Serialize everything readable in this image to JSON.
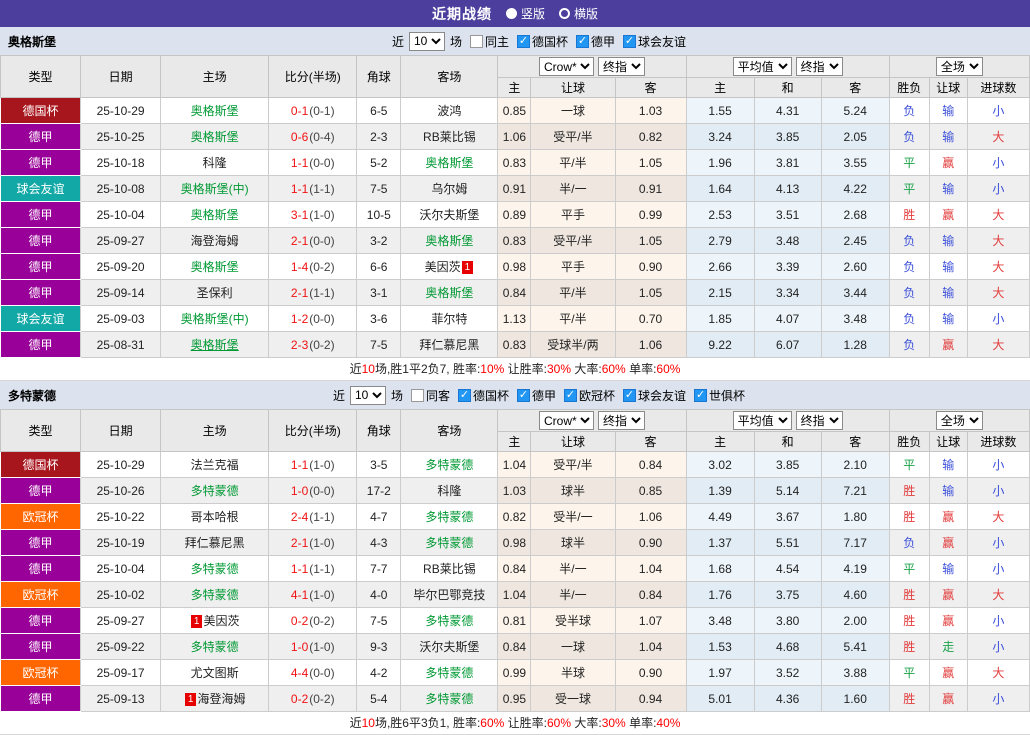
{
  "title_bar": {
    "title": "近期战绩",
    "radios": [
      {
        "label": "竖版",
        "selected": true
      },
      {
        "label": "横版",
        "selected": false
      }
    ]
  },
  "colors": {
    "title_bar_bg": "#4b3e9c",
    "section_bar_bg": "#dce3ee",
    "team_green": "#009933",
    "score_red": "#f01212",
    "badge_red": "#e60000",
    "check_blue": "#2196f3",
    "type": {
      "德国杯": "#a8161d",
      "德甲": "#990099",
      "球会友谊": "#12a8a6",
      "欧冠杯": "#ff6600"
    },
    "result": {
      "r": "#e23b3b",
      "g": "#1ba24a",
      "b": "#3a4fd8"
    }
  },
  "table_header": {
    "left": [
      "类型",
      "日期",
      "主场",
      "比分(半场)",
      "角球",
      "客场"
    ],
    "groups": [
      {
        "selects": [
          "Crow*",
          "终指"
        ],
        "cols": [
          "主",
          "让球",
          "客"
        ]
      },
      {
        "selects": [
          "平均值",
          "终指"
        ],
        "cols": [
          "主",
          "和",
          "客"
        ]
      },
      {
        "selects": [
          "全场"
        ],
        "cols": [
          "胜负",
          "让球",
          "进球数"
        ]
      }
    ]
  },
  "sections": [
    {
      "team": "奥格斯堡",
      "filters": {
        "recent_prefix": "近",
        "recent_value": "10",
        "recent_suffix": "场",
        "same": {
          "label": "同主",
          "checked": false
        },
        "competitions": [
          {
            "label": "德国杯",
            "checked": true
          },
          {
            "label": "德甲",
            "checked": true
          },
          {
            "label": "球会友谊",
            "checked": true
          }
        ]
      },
      "rows": [
        {
          "type": "德国杯",
          "date": "25-10-29",
          "home": {
            "name": "奥格斯堡",
            "green": true
          },
          "score": "0-1",
          "half": "(0-1)",
          "corner": "6-5",
          "away": {
            "name": "波鸿"
          },
          "crow": [
            "0.85",
            "一球",
            "1.03"
          ],
          "avg": [
            "1.55",
            "4.31",
            "5.24"
          ],
          "result": [
            [
              "负",
              "b"
            ],
            [
              "输",
              "b"
            ],
            [
              "小",
              "b"
            ]
          ]
        },
        {
          "type": "德甲",
          "date": "25-10-25",
          "home": {
            "name": "奥格斯堡",
            "green": true
          },
          "score": "0-6",
          "half": "(0-4)",
          "corner": "2-3",
          "away": {
            "name": "RB莱比锡"
          },
          "crow": [
            "1.06",
            "受平/半",
            "0.82"
          ],
          "avg": [
            "3.24",
            "3.85",
            "2.05"
          ],
          "result": [
            [
              "负",
              "b"
            ],
            [
              "输",
              "b"
            ],
            [
              "大",
              "r"
            ]
          ]
        },
        {
          "type": "德甲",
          "date": "25-10-18",
          "home": {
            "name": "科隆"
          },
          "score": "1-1",
          "half": "(0-0)",
          "corner": "5-2",
          "away": {
            "name": "奥格斯堡",
            "green": true
          },
          "crow": [
            "0.83",
            "平/半",
            "1.05"
          ],
          "avg": [
            "1.96",
            "3.81",
            "3.55"
          ],
          "result": [
            [
              "平",
              "g"
            ],
            [
              "赢",
              "r"
            ],
            [
              "小",
              "b"
            ]
          ]
        },
        {
          "type": "球会友谊",
          "date": "25-10-08",
          "home": {
            "name": "奥格斯堡(中)",
            "green": true
          },
          "score": "1-1",
          "half": "(1-1)",
          "corner": "7-5",
          "away": {
            "name": "乌尔姆"
          },
          "crow": [
            "0.91",
            "半/一",
            "0.91"
          ],
          "avg": [
            "1.64",
            "4.13",
            "4.22"
          ],
          "result": [
            [
              "平",
              "g"
            ],
            [
              "输",
              "b"
            ],
            [
              "小",
              "b"
            ]
          ]
        },
        {
          "type": "德甲",
          "date": "25-10-04",
          "home": {
            "name": "奥格斯堡",
            "green": true
          },
          "score": "3-1",
          "half": "(1-0)",
          "corner": "10-5",
          "away": {
            "name": "沃尔夫斯堡"
          },
          "crow": [
            "0.89",
            "平手",
            "0.99"
          ],
          "avg": [
            "2.53",
            "3.51",
            "2.68"
          ],
          "result": [
            [
              "胜",
              "r"
            ],
            [
              "赢",
              "r"
            ],
            [
              "大",
              "r"
            ]
          ]
        },
        {
          "type": "德甲",
          "date": "25-09-27",
          "home": {
            "name": "海登海姆"
          },
          "score": "2-1",
          "half": "(0-0)",
          "corner": "3-2",
          "away": {
            "name": "奥格斯堡",
            "green": true
          },
          "crow": [
            "0.83",
            "受平/半",
            "1.05"
          ],
          "avg": [
            "2.79",
            "3.48",
            "2.45"
          ],
          "result": [
            [
              "负",
              "b"
            ],
            [
              "输",
              "b"
            ],
            [
              "大",
              "r"
            ]
          ]
        },
        {
          "type": "德甲",
          "date": "25-09-20",
          "home": {
            "name": "奥格斯堡",
            "green": true
          },
          "score": "1-4",
          "half": "(0-2)",
          "corner": "6-6",
          "away": {
            "name": "美因茨",
            "badge": "1",
            "badge_pos": "after"
          },
          "crow": [
            "0.98",
            "平手",
            "0.90"
          ],
          "avg": [
            "2.66",
            "3.39",
            "2.60"
          ],
          "result": [
            [
              "负",
              "b"
            ],
            [
              "输",
              "b"
            ],
            [
              "大",
              "r"
            ]
          ]
        },
        {
          "type": "德甲",
          "date": "25-09-14",
          "home": {
            "name": "圣保利"
          },
          "score": "2-1",
          "half": "(1-1)",
          "corner": "3-1",
          "away": {
            "name": "奥格斯堡",
            "green": true
          },
          "crow": [
            "0.84",
            "平/半",
            "1.05"
          ],
          "avg": [
            "2.15",
            "3.34",
            "3.44"
          ],
          "result": [
            [
              "负",
              "b"
            ],
            [
              "输",
              "b"
            ],
            [
              "大",
              "r"
            ]
          ]
        },
        {
          "type": "球会友谊",
          "date": "25-09-03",
          "home": {
            "name": "奥格斯堡(中)",
            "green": true
          },
          "score": "1-2",
          "half": "(0-0)",
          "corner": "3-6",
          "away": {
            "name": "菲尔特"
          },
          "crow": [
            "1.13",
            "平/半",
            "0.70"
          ],
          "avg": [
            "1.85",
            "4.07",
            "3.48"
          ],
          "result": [
            [
              "负",
              "b"
            ],
            [
              "输",
              "b"
            ],
            [
              "小",
              "b"
            ]
          ]
        },
        {
          "type": "德甲",
          "date": "25-08-31",
          "home": {
            "name": "奥格斯堡",
            "green": true,
            "underline": true
          },
          "score": "2-3",
          "half": "(0-2)",
          "corner": "7-5",
          "away": {
            "name": "拜仁慕尼黑"
          },
          "crow": [
            "0.83",
            "受球半/两",
            "1.06"
          ],
          "avg": [
            "9.22",
            "6.07",
            "1.28"
          ],
          "result": [
            [
              "负",
              "b"
            ],
            [
              "赢",
              "r"
            ],
            [
              "大",
              "r"
            ]
          ]
        }
      ],
      "summary": [
        {
          "t": "近"
        },
        {
          "t": "10",
          "red": true
        },
        {
          "t": "场,胜1平2负7, 胜率:"
        },
        {
          "t": "10%",
          "red": true
        },
        {
          "t": " 让胜率:"
        },
        {
          "t": "30%",
          "red": true
        },
        {
          "t": " 大率:"
        },
        {
          "t": "60%",
          "red": true
        },
        {
          "t": " 单率:"
        },
        {
          "t": "60%",
          "red": true
        }
      ]
    },
    {
      "team": "多特蒙德",
      "filters": {
        "recent_prefix": "近",
        "recent_value": "10",
        "recent_suffix": "场",
        "same": {
          "label": "同客",
          "checked": false
        },
        "competitions": [
          {
            "label": "德国杯",
            "checked": true
          },
          {
            "label": "德甲",
            "checked": true
          },
          {
            "label": "欧冠杯",
            "checked": true
          },
          {
            "label": "球会友谊",
            "checked": true
          },
          {
            "label": "世俱杯",
            "checked": true
          }
        ]
      },
      "rows": [
        {
          "type": "德国杯",
          "date": "25-10-29",
          "home": {
            "name": "法兰克福"
          },
          "score": "1-1",
          "half": "(1-0)",
          "corner": "3-5",
          "away": {
            "name": "多特蒙德",
            "green": true
          },
          "crow": [
            "1.04",
            "受平/半",
            "0.84"
          ],
          "avg": [
            "3.02",
            "3.85",
            "2.10"
          ],
          "result": [
            [
              "平",
              "g"
            ],
            [
              "输",
              "b"
            ],
            [
              "小",
              "b"
            ]
          ]
        },
        {
          "type": "德甲",
          "date": "25-10-26",
          "home": {
            "name": "多特蒙德",
            "green": true
          },
          "score": "1-0",
          "half": "(0-0)",
          "corner": "17-2",
          "away": {
            "name": "科隆"
          },
          "crow": [
            "1.03",
            "球半",
            "0.85"
          ],
          "avg": [
            "1.39",
            "5.14",
            "7.21"
          ],
          "result": [
            [
              "胜",
              "r"
            ],
            [
              "输",
              "b"
            ],
            [
              "小",
              "b"
            ]
          ]
        },
        {
          "type": "欧冠杯",
          "date": "25-10-22",
          "home": {
            "name": "哥本哈根"
          },
          "score": "2-4",
          "half": "(1-1)",
          "corner": "4-7",
          "away": {
            "name": "多特蒙德",
            "green": true
          },
          "crow": [
            "0.82",
            "受半/一",
            "1.06"
          ],
          "avg": [
            "4.49",
            "3.67",
            "1.80"
          ],
          "result": [
            [
              "胜",
              "r"
            ],
            [
              "赢",
              "r"
            ],
            [
              "大",
              "r"
            ]
          ]
        },
        {
          "type": "德甲",
          "date": "25-10-19",
          "home": {
            "name": "拜仁慕尼黑"
          },
          "score": "2-1",
          "half": "(1-0)",
          "corner": "4-3",
          "away": {
            "name": "多特蒙德",
            "green": true
          },
          "crow": [
            "0.98",
            "球半",
            "0.90"
          ],
          "avg": [
            "1.37",
            "5.51",
            "7.17"
          ],
          "result": [
            [
              "负",
              "b"
            ],
            [
              "赢",
              "r"
            ],
            [
              "小",
              "b"
            ]
          ]
        },
        {
          "type": "德甲",
          "date": "25-10-04",
          "home": {
            "name": "多特蒙德",
            "green": true
          },
          "score": "1-1",
          "half": "(1-1)",
          "corner": "7-7",
          "away": {
            "name": "RB莱比锡"
          },
          "crow": [
            "0.84",
            "半/一",
            "1.04"
          ],
          "avg": [
            "1.68",
            "4.54",
            "4.19"
          ],
          "result": [
            [
              "平",
              "g"
            ],
            [
              "输",
              "b"
            ],
            [
              "小",
              "b"
            ]
          ]
        },
        {
          "type": "欧冠杯",
          "date": "25-10-02",
          "home": {
            "name": "多特蒙德",
            "green": true
          },
          "score": "4-1",
          "half": "(1-0)",
          "corner": "4-0",
          "away": {
            "name": "毕尔巴鄂竞技"
          },
          "crow": [
            "1.04",
            "半/一",
            "0.84"
          ],
          "avg": [
            "1.76",
            "3.75",
            "4.60"
          ],
          "result": [
            [
              "胜",
              "r"
            ],
            [
              "赢",
              "r"
            ],
            [
              "大",
              "r"
            ]
          ]
        },
        {
          "type": "德甲",
          "date": "25-09-27",
          "home": {
            "name": "美因茨",
            "badge": "1",
            "badge_pos": "before"
          },
          "score": "0-2",
          "half": "(0-2)",
          "corner": "7-5",
          "away": {
            "name": "多特蒙德",
            "green": true
          },
          "crow": [
            "0.81",
            "受半球",
            "1.07"
          ],
          "avg": [
            "3.48",
            "3.80",
            "2.00"
          ],
          "result": [
            [
              "胜",
              "r"
            ],
            [
              "赢",
              "r"
            ],
            [
              "小",
              "b"
            ]
          ]
        },
        {
          "type": "德甲",
          "date": "25-09-22",
          "home": {
            "name": "多特蒙德",
            "green": true
          },
          "score": "1-0",
          "half": "(1-0)",
          "corner": "9-3",
          "away": {
            "name": "沃尔夫斯堡"
          },
          "crow": [
            "0.84",
            "一球",
            "1.04"
          ],
          "avg": [
            "1.53",
            "4.68",
            "5.41"
          ],
          "result": [
            [
              "胜",
              "r"
            ],
            [
              "走",
              "g"
            ],
            [
              "小",
              "b"
            ]
          ]
        },
        {
          "type": "欧冠杯",
          "date": "25-09-17",
          "home": {
            "name": "尤文图斯"
          },
          "score": "4-4",
          "half": "(0-0)",
          "corner": "4-2",
          "away": {
            "name": "多特蒙德",
            "green": true
          },
          "crow": [
            "0.99",
            "半球",
            "0.90"
          ],
          "avg": [
            "1.97",
            "3.52",
            "3.88"
          ],
          "result": [
            [
              "平",
              "g"
            ],
            [
              "赢",
              "r"
            ],
            [
              "大",
              "r"
            ]
          ]
        },
        {
          "type": "德甲",
          "date": "25-09-13",
          "home": {
            "name": "海登海姆",
            "badge": "1",
            "badge_pos": "before"
          },
          "score": "0-2",
          "half": "(0-2)",
          "corner": "5-4",
          "away": {
            "name": "多特蒙德",
            "green": true
          },
          "crow": [
            "0.95",
            "受一球",
            "0.94"
          ],
          "avg": [
            "5.01",
            "4.36",
            "1.60"
          ],
          "result": [
            [
              "胜",
              "r"
            ],
            [
              "赢",
              "r"
            ],
            [
              "小",
              "b"
            ]
          ]
        }
      ],
      "summary": [
        {
          "t": "近"
        },
        {
          "t": "10",
          "red": true
        },
        {
          "t": "场,胜6平3负1, 胜率:"
        },
        {
          "t": "60%",
          "red": true
        },
        {
          "t": " 让胜率:"
        },
        {
          "t": "60%",
          "red": true
        },
        {
          "t": " 大率:"
        },
        {
          "t": "30%",
          "red": true
        },
        {
          "t": " 单率:"
        },
        {
          "t": "40%",
          "red": true
        }
      ]
    }
  ]
}
